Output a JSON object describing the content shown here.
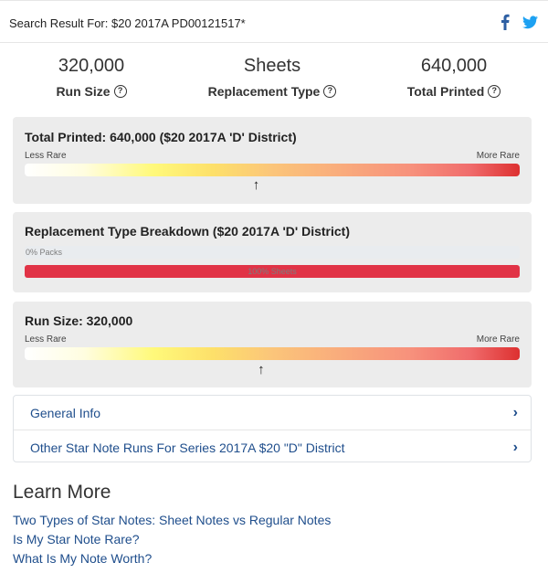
{
  "header": {
    "title": "Search Result For: $20 2017A PD00121517*",
    "share_icons": [
      "facebook-icon",
      "twitter-icon"
    ],
    "facebook_color": "#2d5fa3",
    "twitter_color": "#1da1f2"
  },
  "stats": [
    {
      "value": "320,000",
      "label": "Run Size"
    },
    {
      "value": "Sheets",
      "label": "Replacement Type"
    },
    {
      "value": "640,000",
      "label": "Total Printed"
    }
  ],
  "total_printed_card": {
    "title": "Total Printed: 640,000 ($20 2017A 'D' District)",
    "less_rare": "Less Rare",
    "more_rare": "More Rare",
    "marker_fraction": 0.47
  },
  "breakdown_card": {
    "title": "Replacement Type Breakdown ($20 2017A 'D' District)",
    "packs_label": "0% Packs",
    "packs_fraction": 0.0,
    "sheets_label": "100% Sheets",
    "sheets_fraction": 1.0
  },
  "run_size_card": {
    "title": "Run Size: 320,000",
    "less_rare": "Less Rare",
    "more_rare": "More Rare",
    "marker_fraction": 0.48
  },
  "accordion": {
    "items": [
      {
        "label": "General Info"
      },
      {
        "label": "Other Star Note Runs For Series 2017A $20 \"D\" District"
      }
    ]
  },
  "learn_more": {
    "title": "Learn More",
    "links": [
      "Two Types of Star Notes: Sheet Notes vs Regular Notes",
      "Is My Star Note Rare?",
      "What Is My Note Worth?"
    ]
  },
  "colors": {
    "link": "#1f4e8c",
    "card_bg": "#ececec",
    "sheets_bar": "#e13346"
  }
}
